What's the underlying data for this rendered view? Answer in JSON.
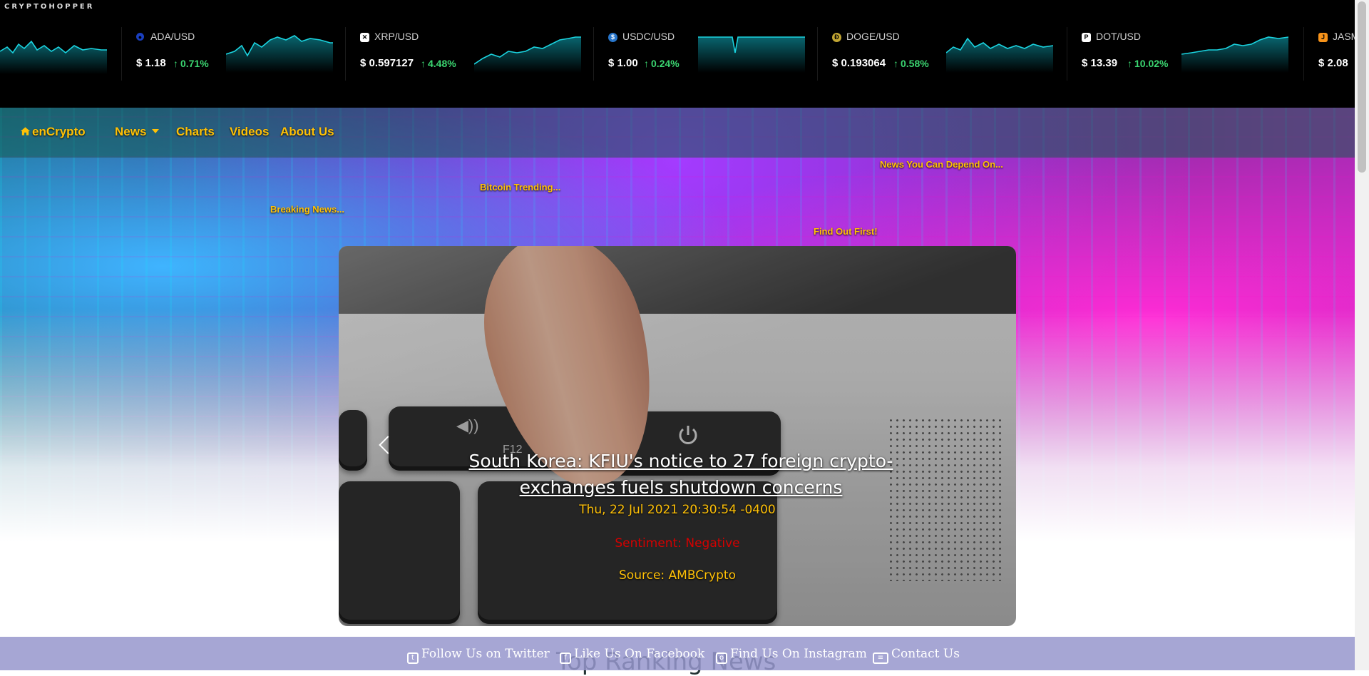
{
  "ticker": {
    "brand": "CRYPTOHOPPER",
    "items": [
      {
        "pair": "ADA/USD",
        "price": "$ 1.18",
        "change": "0.71%",
        "icon": "ada-icon",
        "icon_color": "#1a3fbf",
        "change_color": "#3bd671"
      },
      {
        "pair": "XRP/USD",
        "price": "$ 0.597127",
        "change": "4.48%",
        "icon": "xrp-icon",
        "icon_color": "#ffffff",
        "change_color": "#3bd671"
      },
      {
        "pair": "USDC/USD",
        "price": "$ 1.00",
        "change": "0.24%",
        "icon": "usdc-icon",
        "icon_color": "#2775ca",
        "change_color": "#3bd671"
      },
      {
        "pair": "DOGE/USD",
        "price": "$ 0.193064",
        "change": "0.58%",
        "icon": "doge-icon",
        "icon_color": "#c2a633",
        "change_color": "#3bd671"
      },
      {
        "pair": "DOT/USD",
        "price": "$ 13.39",
        "change": "10.02%",
        "icon": "dot-icon",
        "icon_color": "#ffffff",
        "change_color": "#3bd671"
      },
      {
        "pair": "JASM",
        "price": "$ 2.08",
        "change": "",
        "icon": "jasmy-icon",
        "icon_color": "#f7931a",
        "change_color": "#3bd671"
      }
    ]
  },
  "nav": {
    "brand": "enCrypto",
    "items": {
      "news": "News",
      "charts": "Charts",
      "videos": "Videos",
      "about": "About Us"
    }
  },
  "taglines": {
    "depend": "News You Can Depend On...",
    "trending": "Bitcoin Trending...",
    "breaking": "Breaking News...",
    "first": "Find Out First!"
  },
  "carousel": {
    "headline": "South Korea: KFIU's notice to 27 foreign crypto-exchanges fuels shutdown concerns",
    "date": "Thu, 22 Jul 2021 20:30:54 -0400",
    "sentiment": "Sentiment: Negative",
    "source": "Source: AMBCrypto",
    "key_label": "F12"
  },
  "section": {
    "title": "Top Ranking News"
  },
  "social": {
    "twitter": "Follow Us on Twitter",
    "facebook": "Like Us On Facebook",
    "instagram": "Find Us On Instagram",
    "contact": "Contact Us"
  },
  "colors": {
    "accent": "#ffc107",
    "negative": "#d40000",
    "positive": "#3bd671",
    "social_bar": "#9696cd"
  }
}
